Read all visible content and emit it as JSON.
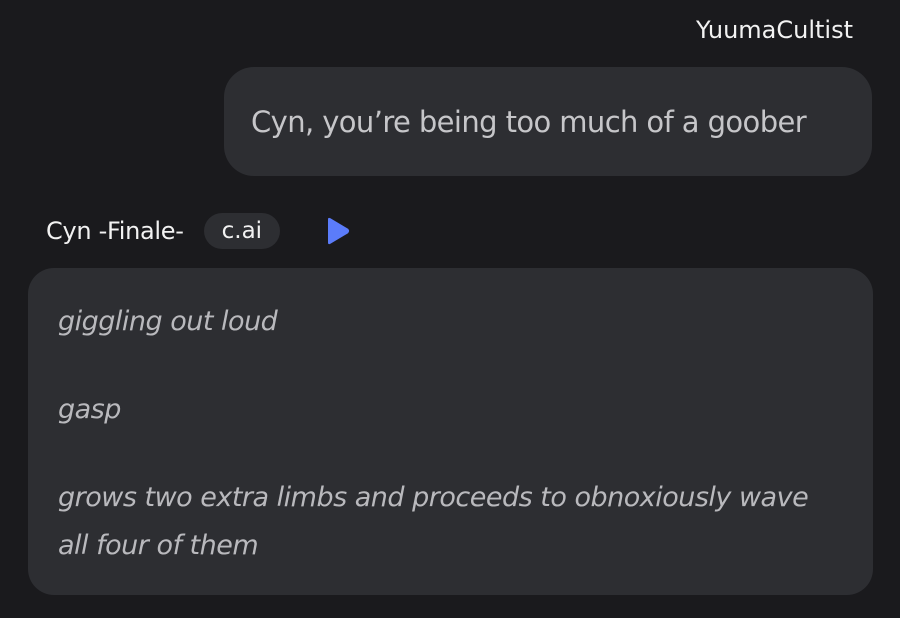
{
  "user_message": {
    "username": "YuumaCultist",
    "text": "Cyn, you’re being too much of a goober"
  },
  "character_message": {
    "name": "Cyn -Finale-",
    "badge": "c.ai",
    "play_icon": "play-icon",
    "lines": [
      "giggling out loud",
      "gasp",
      "grows two extra limbs and proceeds to obnoxiously wave all four of them"
    ]
  },
  "colors": {
    "background": "#1a1a1d",
    "bubble": "#2d2e32",
    "accent_play": "#5b7cfa"
  }
}
